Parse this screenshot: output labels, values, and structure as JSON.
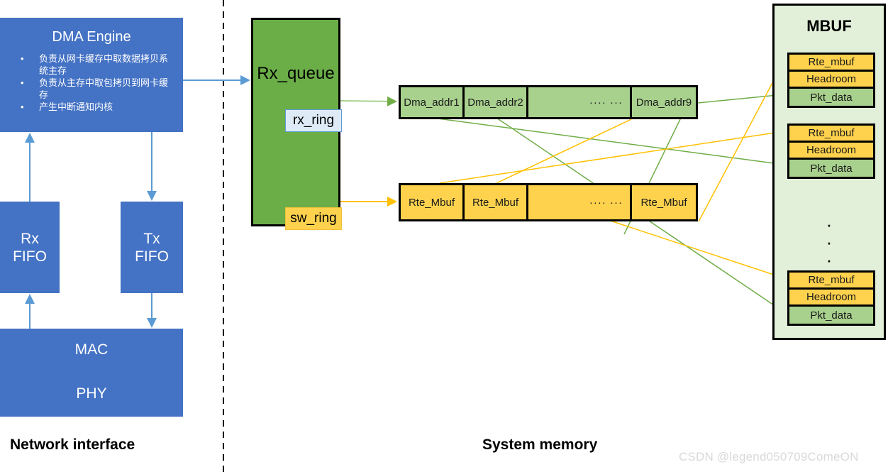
{
  "nic": {
    "dma": {
      "title": "DMA Engine",
      "bullets": [
        "负责从网卡缓存中取数据拷贝系统主存",
        "负责从主存中取包拷贝到网卡缓存",
        "产生中断通知内核"
      ]
    },
    "rx_fifo": "Rx\nFIFO",
    "rx_fifo_line1": "Rx",
    "rx_fifo_line2": "FIFO",
    "tx_fifo_line1": "Tx",
    "tx_fifo_line2": "FIFO",
    "mac": "MAC",
    "phy": "PHY"
  },
  "rx_queue": {
    "title": "Rx_queue",
    "rx_ring": "rx_ring",
    "sw_ring": "sw_ring"
  },
  "dma_array": {
    "cells": [
      "Dma_addr1",
      "Dma_addr2",
      "···· ···",
      "Dma_addr9"
    ]
  },
  "mbuf_array": {
    "cells": [
      "Rte_Mbuf",
      "Rte_Mbuf",
      "···· ···",
      "Rte_Mbuf"
    ]
  },
  "mbuf_panel": {
    "title": "MBUF",
    "vertical_dots": "·\n·\n·",
    "groups": [
      {
        "rows": [
          "Rte_mbuf",
          "Headroom",
          "Pkt_data"
        ]
      },
      {
        "rows": [
          "Rte_mbuf",
          "Headroom",
          "Pkt_data"
        ]
      },
      {
        "rows": [
          "Rte_mbuf",
          "Headroom",
          "Pkt_data"
        ]
      }
    ]
  },
  "zones": {
    "network_interface": "Network interface",
    "system_memory": "System memory"
  },
  "watermark": "CSDN @legend050709ComeON",
  "colors": {
    "blue": "#4472C4",
    "green": "#6BAE48",
    "light_green": "#A9D18E",
    "panel_green": "#E2EFD9",
    "yellow": "#FFD24D",
    "pale_blue": "#DEEBF7",
    "arrow_blue": "#5B9BD5",
    "arrow_green": "#70AD47",
    "arrow_yellow": "#FFC000",
    "watermark_gray": "#d9d9d9"
  }
}
